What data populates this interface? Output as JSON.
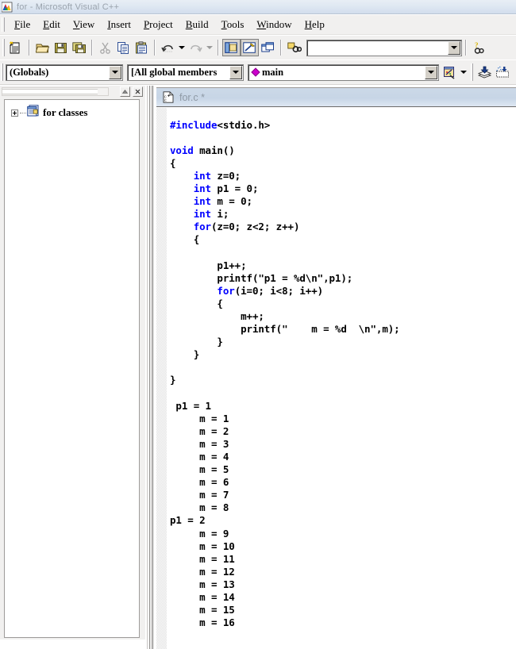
{
  "window": {
    "title": "for - Microsoft Visual C++",
    "icon": "visual-cpp-app-icon"
  },
  "menu": {
    "items": [
      {
        "label": "File",
        "accel": "F"
      },
      {
        "label": "Edit",
        "accel": "E"
      },
      {
        "label": "View",
        "accel": "V"
      },
      {
        "label": "Insert",
        "accel": "I"
      },
      {
        "label": "Project",
        "accel": "P"
      },
      {
        "label": "Build",
        "accel": "B"
      },
      {
        "label": "Tools",
        "accel": "T"
      },
      {
        "label": "Window",
        "accel": "W"
      },
      {
        "label": "Help",
        "accel": "H"
      }
    ]
  },
  "toolbar_standard": {
    "buttons": [
      {
        "name": "new-text-file-icon",
        "title": "New Text File"
      },
      {
        "name": "open-icon",
        "title": "Open"
      },
      {
        "name": "save-icon",
        "title": "Save"
      },
      {
        "name": "save-all-icon",
        "title": "Save All"
      },
      {
        "name": "cut-icon",
        "title": "Cut"
      },
      {
        "name": "copy-icon",
        "title": "Copy"
      },
      {
        "name": "paste-icon",
        "title": "Paste"
      },
      {
        "name": "undo-icon",
        "title": "Undo"
      },
      {
        "name": "redo-icon",
        "title": "Redo"
      },
      {
        "name": "workspace-icon",
        "title": "Workspace"
      },
      {
        "name": "output-icon",
        "title": "Output"
      },
      {
        "name": "window-list-icon",
        "title": "Window List"
      },
      {
        "name": "find-in-files-icon",
        "title": "Find in Files"
      },
      {
        "name": "search-help-icon",
        "title": "Search"
      }
    ],
    "find_box": {
      "value": "",
      "placeholder": ""
    }
  },
  "toolbar_wizardbar": {
    "globals_combo": {
      "value": "(Globals)"
    },
    "members_combo": {
      "value": "[All global members"
    },
    "symbol_combo": {
      "value": "main",
      "icon": "magenta-diamond-icon"
    },
    "action_button": {
      "name": "wizardbar-action-icon"
    },
    "buttons": [
      {
        "name": "compile-icon",
        "title": "Compile"
      },
      {
        "name": "build-icon",
        "title": "Build"
      }
    ]
  },
  "workspace_pane": {
    "minimize_button": "minimize-pane-button",
    "close_button": "close-pane-button",
    "tree": [
      {
        "label": "for classes",
        "icon": "class-view-folder-icon",
        "expanded": false
      }
    ]
  },
  "editor": {
    "tab": {
      "label": "for.c *",
      "icon": "c-source-file-icon"
    },
    "code_lines": [
      {
        "segments": [
          {
            "t": "#include",
            "c": "pre"
          },
          {
            "t": "<stdio.h>",
            "c": "plain"
          }
        ]
      },
      {
        "segments": []
      },
      {
        "segments": [
          {
            "t": "void",
            "c": "kw"
          },
          {
            "t": " main()",
            "c": "plain"
          }
        ]
      },
      {
        "segments": [
          {
            "t": "{",
            "c": "plain"
          }
        ]
      },
      {
        "segments": [
          {
            "t": "    ",
            "c": "plain"
          },
          {
            "t": "int",
            "c": "kw"
          },
          {
            "t": " z=0;",
            "c": "plain"
          }
        ]
      },
      {
        "segments": [
          {
            "t": "    ",
            "c": "plain"
          },
          {
            "t": "int",
            "c": "kw"
          },
          {
            "t": " p1 = 0;",
            "c": "plain"
          }
        ]
      },
      {
        "segments": [
          {
            "t": "    ",
            "c": "plain"
          },
          {
            "t": "int",
            "c": "kw"
          },
          {
            "t": " m = 0;",
            "c": "plain"
          }
        ]
      },
      {
        "segments": [
          {
            "t": "    ",
            "c": "plain"
          },
          {
            "t": "int",
            "c": "kw"
          },
          {
            "t": " i;",
            "c": "plain"
          }
        ]
      },
      {
        "segments": [
          {
            "t": "    ",
            "c": "plain"
          },
          {
            "t": "for",
            "c": "kw"
          },
          {
            "t": "(z=0; z<2; z++)",
            "c": "plain"
          }
        ]
      },
      {
        "segments": [
          {
            "t": "    {",
            "c": "plain"
          }
        ]
      },
      {
        "segments": []
      },
      {
        "segments": [
          {
            "t": "        p1++;",
            "c": "plain"
          }
        ]
      },
      {
        "segments": [
          {
            "t": "        printf(\"p1 = %d\\n\",p1);",
            "c": "plain"
          }
        ]
      },
      {
        "segments": [
          {
            "t": "        ",
            "c": "plain"
          },
          {
            "t": "for",
            "c": "kw"
          },
          {
            "t": "(i=0; i<8; i++)",
            "c": "plain"
          }
        ]
      },
      {
        "segments": [
          {
            "t": "        {",
            "c": "plain"
          }
        ]
      },
      {
        "segments": [
          {
            "t": "            m++;",
            "c": "plain"
          }
        ]
      },
      {
        "segments": [
          {
            "t": "            printf(\"    m = %d  \\n\",m);",
            "c": "plain"
          }
        ]
      },
      {
        "segments": [
          {
            "t": "        }",
            "c": "plain"
          }
        ]
      },
      {
        "segments": [
          {
            "t": "    }",
            "c": "plain"
          }
        ]
      },
      {
        "segments": []
      },
      {
        "segments": [
          {
            "t": "}",
            "c": "plain"
          }
        ]
      },
      {
        "segments": []
      },
      {
        "segments": [
          {
            "t": " p1 = 1",
            "c": "plain"
          }
        ]
      },
      {
        "segments": [
          {
            "t": "     m = 1",
            "c": "plain"
          }
        ]
      },
      {
        "segments": [
          {
            "t": "     m = 2",
            "c": "plain"
          }
        ]
      },
      {
        "segments": [
          {
            "t": "     m = 3",
            "c": "plain"
          }
        ]
      },
      {
        "segments": [
          {
            "t": "     m = 4",
            "c": "plain"
          }
        ]
      },
      {
        "segments": [
          {
            "t": "     m = 5",
            "c": "plain"
          }
        ]
      },
      {
        "segments": [
          {
            "t": "     m = 6",
            "c": "plain"
          }
        ]
      },
      {
        "segments": [
          {
            "t": "     m = 7",
            "c": "plain"
          }
        ]
      },
      {
        "segments": [
          {
            "t": "     m = 8",
            "c": "plain"
          }
        ]
      },
      {
        "segments": [
          {
            "t": "p1 = 2",
            "c": "plain"
          }
        ]
      },
      {
        "segments": [
          {
            "t": "     m = 9",
            "c": "plain"
          }
        ]
      },
      {
        "segments": [
          {
            "t": "     m = 10",
            "c": "plain"
          }
        ]
      },
      {
        "segments": [
          {
            "t": "     m = 11",
            "c": "plain"
          }
        ]
      },
      {
        "segments": [
          {
            "t": "     m = 12",
            "c": "plain"
          }
        ]
      },
      {
        "segments": [
          {
            "t": "     m = 13",
            "c": "plain"
          }
        ]
      },
      {
        "segments": [
          {
            "t": "     m = 14",
            "c": "plain"
          }
        ]
      },
      {
        "segments": [
          {
            "t": "     m = 15",
            "c": "plain"
          }
        ]
      },
      {
        "segments": [
          {
            "t": "     m = 16",
            "c": "plain"
          }
        ]
      }
    ]
  },
  "colors": {
    "keyword": "#0000ff",
    "text": "#000000",
    "editor_bg": "#ffffff",
    "chrome_bg": "#f1f0ef",
    "tab_gradient_start": "#ccd9e8",
    "title_gradient_start": "#e8eef5"
  }
}
